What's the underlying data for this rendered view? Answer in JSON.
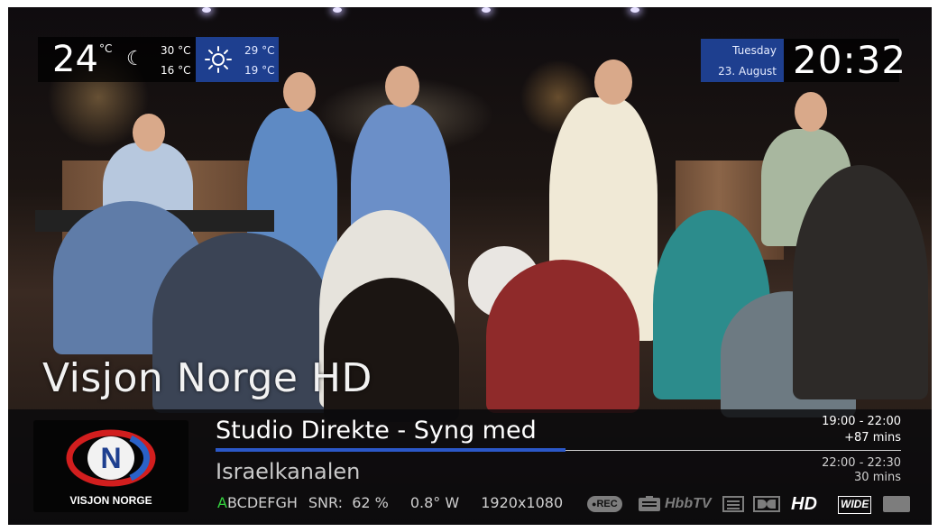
{
  "weather": {
    "current_temp": "24",
    "temp_unit": "°C",
    "tonight_high": "30 °C",
    "tonight_low": "16 °C",
    "day_high": "29 °C",
    "day_low": "19 °C",
    "night_icon": "moon-icon",
    "day_icon": "sun-icon"
  },
  "clock": {
    "weekday": "Tuesday",
    "date": "23. August",
    "time": "20:32"
  },
  "channel": {
    "name": "Visjon Norge HD",
    "logo_text": "VISJON NORGE",
    "logo_letter": "N"
  },
  "now": {
    "title": "Studio Direkte - Syng med",
    "time_range": "19:00  -  22:00",
    "remaining": "+87 mins",
    "progress": 0.51
  },
  "next": {
    "title": "Israelkanalen",
    "time_range": "22:00  -  22:30",
    "duration": "30 mins"
  },
  "signal": {
    "ci_active_letter": "A",
    "ci_other_letters": "BCDEFGH",
    "snr_label": "SNR:",
    "snr_value": "62 %",
    "orbital": "0.8° W",
    "resolution": "1920x1080"
  },
  "status_icons": {
    "rec": "REC",
    "hbbtv": "HbbTV",
    "hd": "HD",
    "wide": "WIDE"
  },
  "colors": {
    "accent_blue": "#1e3f8f",
    "progress_blue": "#2b58c8",
    "ci_green": "#34d13e"
  }
}
